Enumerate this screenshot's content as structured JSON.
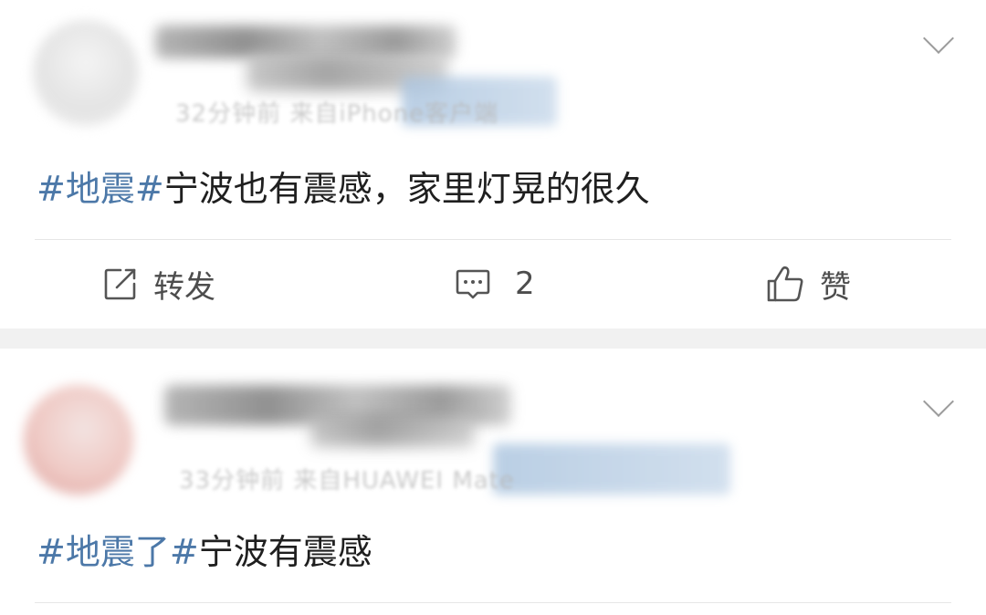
{
  "posts": [
    {
      "meta": "32分钟前 来自iPhone客户端",
      "topic": "#地震#",
      "text": "宁波也有震感，家里灯晃的很久",
      "actions": {
        "repost": "转发",
        "comment": "2",
        "like": "赞"
      }
    },
    {
      "meta": "33分钟前 来自HUAWEI Mate",
      "topic": "#地震了#",
      "text": "宁波有震感"
    }
  ],
  "icons": {
    "repost": "edit-share-icon",
    "comment": "comment-bubble-icon",
    "like": "thumbs-up-icon",
    "more": "chevron-down-icon"
  },
  "colors": {
    "topic": "#4c78a8",
    "text": "#1f1f1f",
    "action_text": "#4d4d4d",
    "separator": "#f1f1f1"
  }
}
